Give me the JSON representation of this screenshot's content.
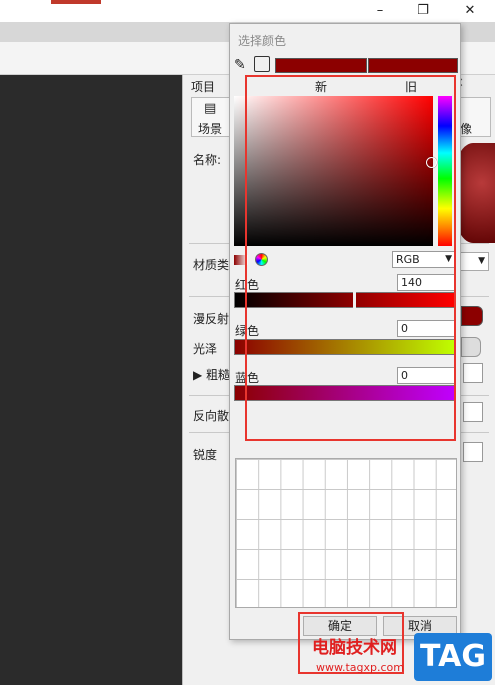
{
  "window": {
    "controls": {
      "minimize": "–",
      "restore": "❐",
      "close": "✕"
    }
  },
  "panel": {
    "header": "项目",
    "tabs": [
      {
        "label": "场景"
      },
      {
        "label": "像"
      }
    ],
    "name_label": "名称:",
    "material_label": "材质类",
    "diffuse_label": "漫反射",
    "gloss_label": "光泽",
    "rough_label": "▶ 粗糙",
    "reflect_label": "反向散",
    "sharp_label": "锐度"
  },
  "dialog": {
    "title": "选择颜色",
    "new_label": "新",
    "old_label": "旧",
    "new_color": "#8c0000",
    "old_color": "#8c0000",
    "mode": "RGB",
    "channels": {
      "red": {
        "label": "红色",
        "value": "140"
      },
      "green": {
        "label": "绿色",
        "value": "0"
      },
      "blue": {
        "label": "蓝色",
        "value": "0"
      }
    },
    "ok_label": "确定",
    "cancel_label": "取消"
  },
  "watermark": {
    "text": "电脑技术网",
    "url": "www.tagxp.com",
    "badge": "TAG"
  },
  "colors": {
    "annotation": "#e8352e",
    "accent_blue": "#1e7dd8"
  }
}
